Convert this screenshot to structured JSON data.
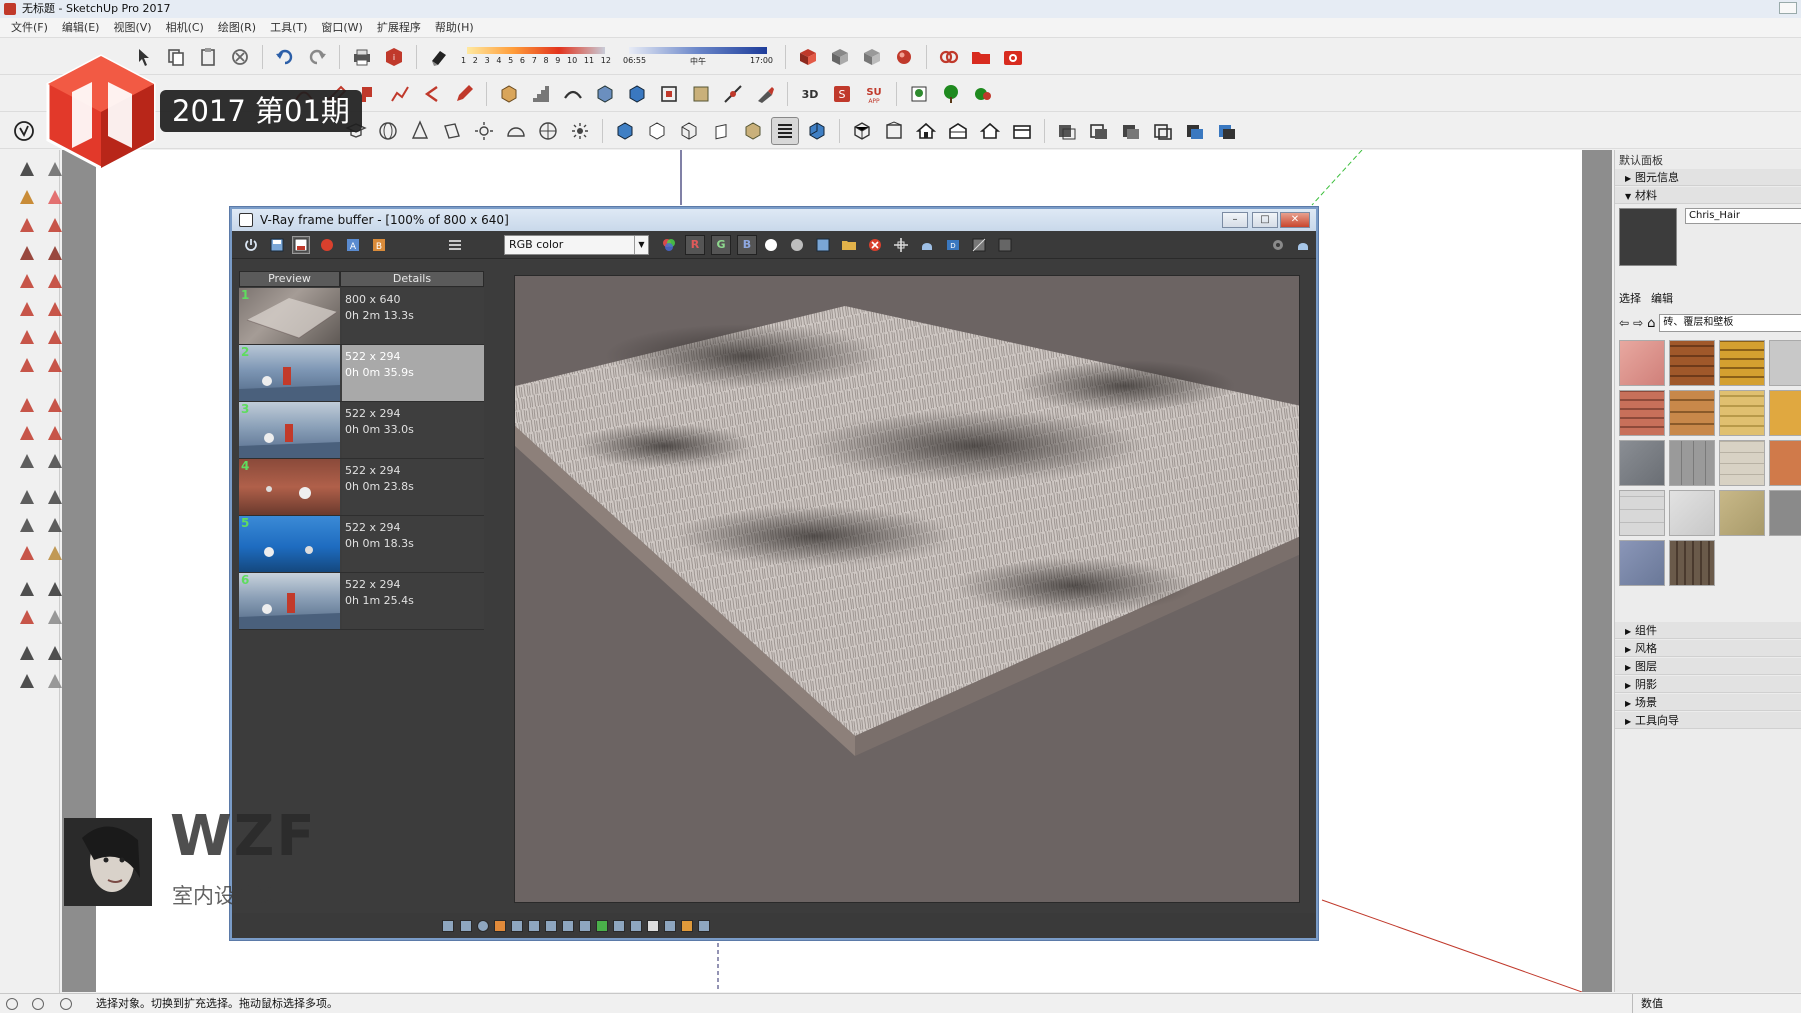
{
  "app": {
    "window_title": "无标题 - SketchUp Pro 2017",
    "menu": [
      "文件(F)",
      "编辑(E)",
      "视图(V)",
      "相机(C)",
      "绘图(R)",
      "工具(T)",
      "窗口(W)",
      "扩展程序",
      "帮助(H)"
    ]
  },
  "toolbar": {
    "shadow_scale": [
      "1",
      "2",
      "3",
      "4",
      "5",
      "6",
      "7",
      "8",
      "9",
      "10",
      "11",
      "12"
    ],
    "time_start": "06:55",
    "time_mid": "中午",
    "time_end": "17:00"
  },
  "badge": {
    "label": "2017 第01期"
  },
  "watermark": {
    "name": "WZF",
    "subtitle": "室内设计课"
  },
  "vfb": {
    "title": "V-Ray frame buffer - [100% of 800 x 640]",
    "channel": "RGB color",
    "channel_buttons": [
      "R",
      "G",
      "B"
    ],
    "history_headers": {
      "preview": "Preview",
      "details": "Details"
    },
    "history": [
      {
        "num": "1",
        "size": "800 x 640",
        "time": "0h 2m 13.3s",
        "selected": false
      },
      {
        "num": "2",
        "size": "522 x 294",
        "time": "0h 0m 35.9s",
        "selected": true
      },
      {
        "num": "3",
        "size": "522 x 294",
        "time": "0h 0m 33.0s",
        "selected": false
      },
      {
        "num": "4",
        "size": "522 x 294",
        "time": "0h 0m 23.8s",
        "selected": false
      },
      {
        "num": "5",
        "size": "522 x 294",
        "time": "0h 0m 18.3s",
        "selected": false
      },
      {
        "num": "6",
        "size": "522 x 294",
        "time": "0h 1m 25.4s",
        "selected": false
      }
    ]
  },
  "tray": {
    "title": "默认面板",
    "entity_info": "图元信息",
    "materials": "材料",
    "material_name": "Chris_Hair",
    "tab_select": "选择",
    "tab_edit": "编辑",
    "collection": "砖、覆层和壁板",
    "sections": [
      "组件",
      "风格",
      "图层",
      "阴影",
      "场景",
      "工具向导"
    ]
  },
  "status": {
    "text": "选择对象。切换到扩充选择。拖动鼠标选择多项。",
    "measurements_label": "数值"
  },
  "colors": {
    "vfb_border": "#7a9cc8",
    "history_selected": "#a9a9a9",
    "render_bg": "#6c6463",
    "history_number": "#5fdc5f"
  }
}
